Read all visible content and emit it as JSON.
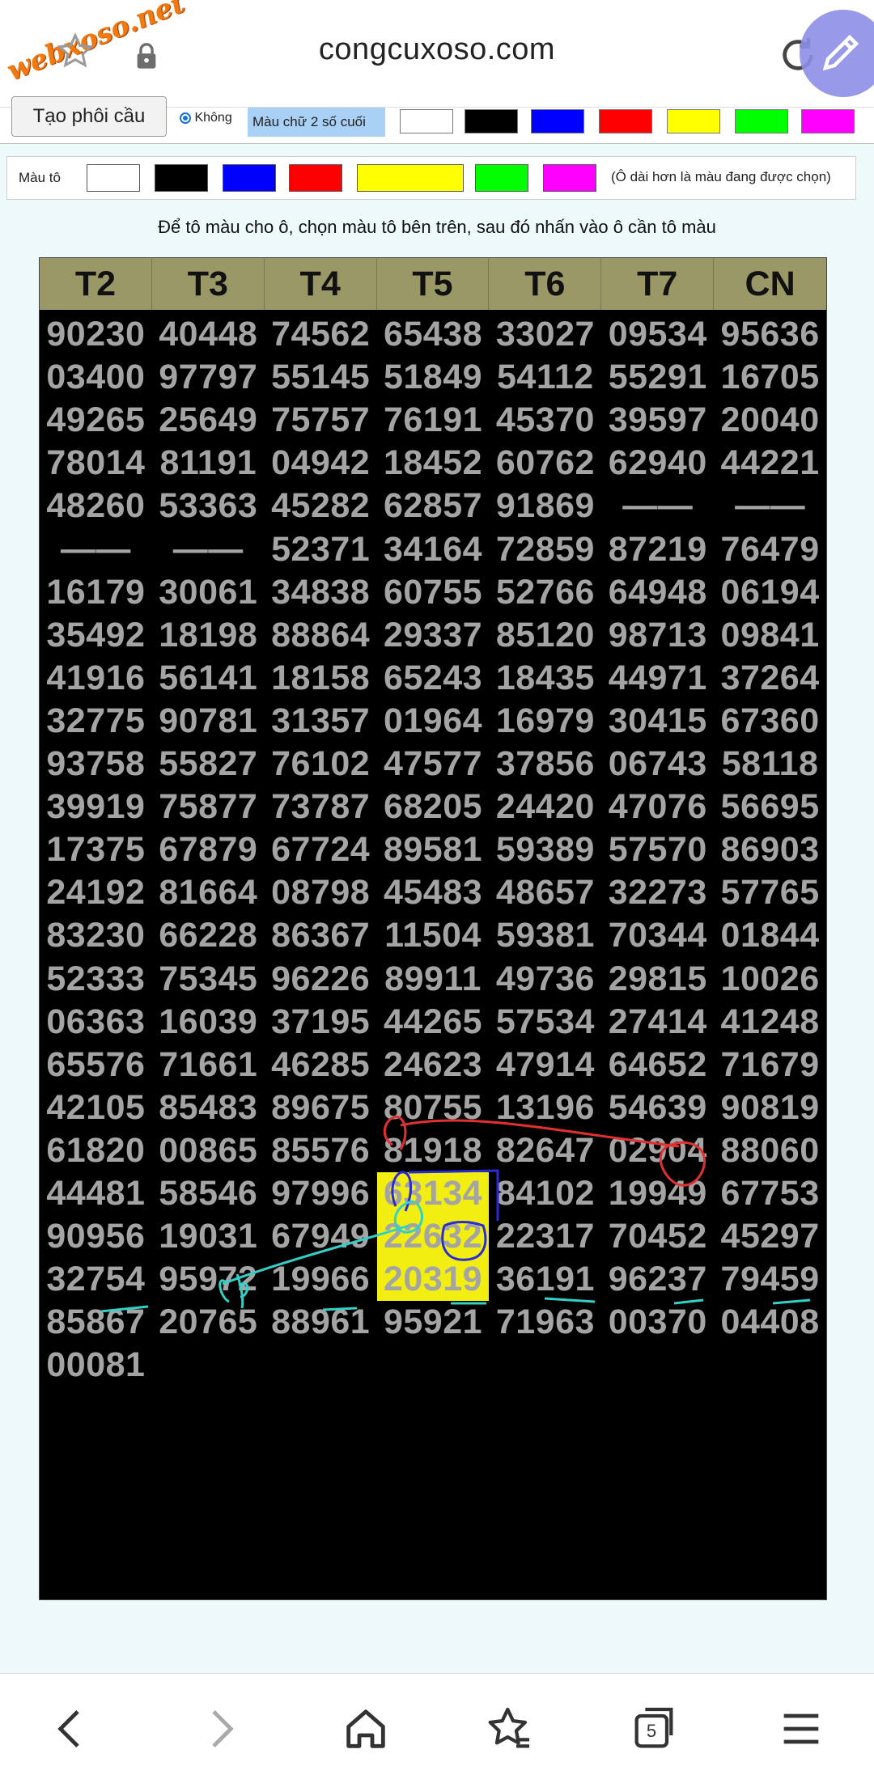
{
  "browser": {
    "watermark": "webxoso.net",
    "url": "congcuxoso.com",
    "tab_count": "5"
  },
  "options": {
    "create_button": "Tạo phôi cầu",
    "radio_label": "Không",
    "two_digit_color_label": "Màu chữ 2 số cuối",
    "swatches": [
      "#ffffff",
      "#000000",
      "#0000ff",
      "#ff0000",
      "#ffff00",
      "#00ff00",
      "#ff00ff"
    ]
  },
  "color_picker": {
    "label": "Màu tô",
    "note": "(Ô dài hơn là màu đang được chọn)",
    "swatches": [
      "#ffffff",
      "#000000",
      "#0000ff",
      "#ff0000",
      "#ffff00",
      "#00ff00",
      "#ff00ff"
    ],
    "selected": "#ffff00"
  },
  "instruction": "Để tô màu cho ô, chọn màu tô bên trên, sau đó nhấn vào ô cần tô màu",
  "table": {
    "headers": [
      "T2",
      "T3",
      "T4",
      "T5",
      "T6",
      "T7",
      "CN"
    ],
    "rows": [
      [
        "90230",
        "40448",
        "74562",
        "65438",
        "33027",
        "09534",
        "95636"
      ],
      [
        "03400",
        "97797",
        "55145",
        "51849",
        "54112",
        "55291",
        "16705"
      ],
      [
        "49265",
        "25649",
        "75757",
        "76191",
        "45370",
        "39597",
        "20040"
      ],
      [
        "78014",
        "81191",
        "04942",
        "18452",
        "60762",
        "62940",
        "44221"
      ],
      [
        "48260",
        "53363",
        "45282",
        "62857",
        "91869",
        "——",
        "——"
      ],
      [
        "——",
        "——",
        "52371",
        "34164",
        "72859",
        "87219",
        "76479"
      ],
      [
        "16179",
        "30061",
        "34838",
        "60755",
        "52766",
        "64948",
        "06194"
      ],
      [
        "35492",
        "18198",
        "88864",
        "29337",
        "85120",
        "98713",
        "09841"
      ],
      [
        "41916",
        "56141",
        "18158",
        "65243",
        "18435",
        "44971",
        "37264"
      ],
      [
        "32775",
        "90781",
        "31357",
        "01964",
        "16979",
        "30415",
        "67360"
      ],
      [
        "93758",
        "55827",
        "76102",
        "47577",
        "37856",
        "06743",
        "58118"
      ],
      [
        "39919",
        "75877",
        "73787",
        "68205",
        "24420",
        "47076",
        "56695"
      ],
      [
        "17375",
        "67879",
        "67724",
        "89581",
        "59389",
        "57570",
        "86903"
      ],
      [
        "24192",
        "81664",
        "08798",
        "45483",
        "48657",
        "32273",
        "57765"
      ],
      [
        "83230",
        "66228",
        "86367",
        "11504",
        "59381",
        "70344",
        "01844"
      ],
      [
        "52333",
        "75345",
        "96226",
        "89911",
        "49736",
        "29815",
        "10026"
      ],
      [
        "06363",
        "16039",
        "37195",
        "44265",
        "57534",
        "27414",
        "41248"
      ],
      [
        "65576",
        "71661",
        "46285",
        "24623",
        "47914",
        "64652",
        "71679"
      ],
      [
        "42105",
        "85483",
        "89675",
        "80755",
        "13196",
        "54639",
        "90819"
      ],
      [
        "61820",
        "00865",
        "85576",
        "81918",
        "82647",
        "02904",
        "88060"
      ],
      [
        "44481",
        "58546",
        "97996",
        "63134",
        "84102",
        "19949",
        "67753"
      ],
      [
        "90956",
        "19031",
        "67949",
        "22632",
        "22317",
        "70452",
        "45297"
      ],
      [
        "32754",
        "95972",
        "19966",
        "20319",
        "36191",
        "96237",
        "79459"
      ],
      [
        "85867",
        "20765",
        "88961",
        "95921",
        "71963",
        "00370",
        "04408"
      ],
      [
        "00081",
        "",
        "",
        "",
        "",
        "",
        ""
      ]
    ],
    "highlighted": [
      [
        20,
        3
      ],
      [
        21,
        3
      ],
      [
        22,
        3
      ]
    ],
    "highlight_color": "#f2ee12",
    "handwritten_note": "0P"
  }
}
